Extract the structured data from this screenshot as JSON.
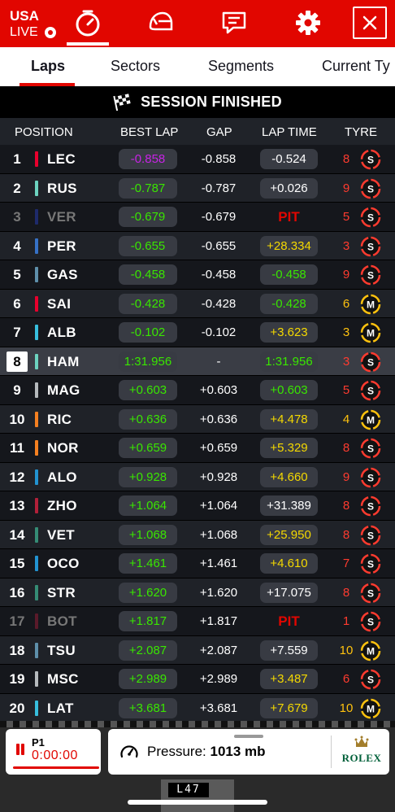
{
  "header": {
    "event": "USA",
    "live_label": "LIVE",
    "close_icon": "close-icon"
  },
  "tabs": [
    "Laps",
    "Sectors",
    "Segments",
    "Current Ty"
  ],
  "banner": {
    "text": "SESSION FINISHED",
    "icon": "checkered-flag-icon"
  },
  "columns": {
    "position": "POSITION",
    "best_lap": "BEST LAP",
    "gap": "GAP",
    "lap_time": "LAP TIME",
    "tyre": "TYRE"
  },
  "colors": {
    "accent": "#e10600",
    "purple": "#c823e6",
    "green": "#39e600",
    "yellow": "#f4d800",
    "soft": "#ff3b2f",
    "medium": "#ffc20e"
  },
  "rows": [
    {
      "pos": "1",
      "driver": "LEC",
      "team": "#e8002d",
      "best": "-0.858",
      "best_c": "purple",
      "gap": "-0.858",
      "lap": "-0.524",
      "lap_c": "white",
      "age": "8",
      "tyre": "S"
    },
    {
      "pos": "2",
      "driver": "RUS",
      "team": "#6cd3bf",
      "best": "-0.787",
      "best_c": "green",
      "gap": "-0.787",
      "lap": "+0.026",
      "lap_c": "white",
      "age": "9",
      "tyre": "S"
    },
    {
      "pos": "3",
      "driver": "VER",
      "team": "#1e2a6b",
      "best": "-0.679",
      "best_c": "green",
      "gap": "-0.679",
      "lap": "PIT",
      "lap_c": "pit",
      "age": "5",
      "tyre": "S",
      "dim": true
    },
    {
      "pos": "4",
      "driver": "PER",
      "team": "#3671c6",
      "best": "-0.655",
      "best_c": "green",
      "gap": "-0.655",
      "lap": "+28.334",
      "lap_c": "yellow",
      "age": "3",
      "tyre": "S"
    },
    {
      "pos": "5",
      "driver": "GAS",
      "team": "#5e8faa",
      "best": "-0.458",
      "best_c": "green",
      "gap": "-0.458",
      "lap": "-0.458",
      "lap_c": "green",
      "age": "9",
      "tyre": "S"
    },
    {
      "pos": "6",
      "driver": "SAI",
      "team": "#e8002d",
      "best": "-0.428",
      "best_c": "green",
      "gap": "-0.428",
      "lap": "-0.428",
      "lap_c": "green",
      "age": "6",
      "tyre": "M"
    },
    {
      "pos": "7",
      "driver": "ALB",
      "team": "#37bedd",
      "best": "-0.102",
      "best_c": "green",
      "gap": "-0.102",
      "lap": "+3.623",
      "lap_c": "yellow",
      "age": "3",
      "tyre": "M"
    },
    {
      "pos": "8",
      "driver": "HAM",
      "team": "#6cd3bf",
      "best": "1:31.956",
      "best_c": "green",
      "gap": "-",
      "lap": "1:31.956",
      "lap_c": "green",
      "age": "3",
      "tyre": "S",
      "hl": true
    },
    {
      "pos": "9",
      "driver": "MAG",
      "team": "#b6babd",
      "best": "+0.603",
      "best_c": "green",
      "gap": "+0.603",
      "lap": "+0.603",
      "lap_c": "green",
      "age": "5",
      "tyre": "S"
    },
    {
      "pos": "10",
      "driver": "RIC",
      "team": "#f58020",
      "best": "+0.636",
      "best_c": "green",
      "gap": "+0.636",
      "lap": "+4.478",
      "lap_c": "yellow",
      "age": "4",
      "tyre": "M"
    },
    {
      "pos": "11",
      "driver": "NOR",
      "team": "#f58020",
      "best": "+0.659",
      "best_c": "green",
      "gap": "+0.659",
      "lap": "+5.329",
      "lap_c": "yellow",
      "age": "8",
      "tyre": "S"
    },
    {
      "pos": "12",
      "driver": "ALO",
      "team": "#2293d1",
      "best": "+0.928",
      "best_c": "green",
      "gap": "+0.928",
      "lap": "+4.660",
      "lap_c": "yellow",
      "age": "9",
      "tyre": "S"
    },
    {
      "pos": "13",
      "driver": "ZHO",
      "team": "#b12039",
      "best": "+1.064",
      "best_c": "green",
      "gap": "+1.064",
      "lap": "+31.389",
      "lap_c": "white",
      "age": "8",
      "tyre": "S"
    },
    {
      "pos": "14",
      "driver": "VET",
      "team": "#358c75",
      "best": "+1.068",
      "best_c": "green",
      "gap": "+1.068",
      "lap": "+25.950",
      "lap_c": "yellow",
      "age": "8",
      "tyre": "S"
    },
    {
      "pos": "15",
      "driver": "OCO",
      "team": "#2293d1",
      "best": "+1.461",
      "best_c": "green",
      "gap": "+1.461",
      "lap": "+4.610",
      "lap_c": "yellow",
      "age": "7",
      "tyre": "S"
    },
    {
      "pos": "16",
      "driver": "STR",
      "team": "#358c75",
      "best": "+1.620",
      "best_c": "green",
      "gap": "+1.620",
      "lap": "+17.075",
      "lap_c": "white",
      "age": "8",
      "tyre": "S"
    },
    {
      "pos": "17",
      "driver": "BOT",
      "team": "#5a1a2a",
      "best": "+1.817",
      "best_c": "green",
      "gap": "+1.817",
      "lap": "PIT",
      "lap_c": "pit",
      "age": "1",
      "tyre": "S",
      "dim": true
    },
    {
      "pos": "18",
      "driver": "TSU",
      "team": "#5e8faa",
      "best": "+2.087",
      "best_c": "green",
      "gap": "+2.087",
      "lap": "+7.559",
      "lap_c": "white",
      "age": "10",
      "tyre": "M"
    },
    {
      "pos": "19",
      "driver": "MSC",
      "team": "#b6babd",
      "best": "+2.989",
      "best_c": "green",
      "gap": "+2.989",
      "lap": "+3.487",
      "lap_c": "yellow",
      "age": "6",
      "tyre": "S"
    },
    {
      "pos": "20",
      "driver": "LAT",
      "team": "#37bedd",
      "best": "+3.681",
      "best_c": "green",
      "gap": "+3.681",
      "lap": "+7.679",
      "lap_c": "yellow",
      "age": "10",
      "tyre": "M"
    }
  ],
  "footer": {
    "position_label": "P1",
    "timer": "0:00:00",
    "pressure_label": "Pressure:",
    "pressure_value": "1013 mb",
    "sponsor": "ROLEX",
    "lap_counter": "L47"
  }
}
